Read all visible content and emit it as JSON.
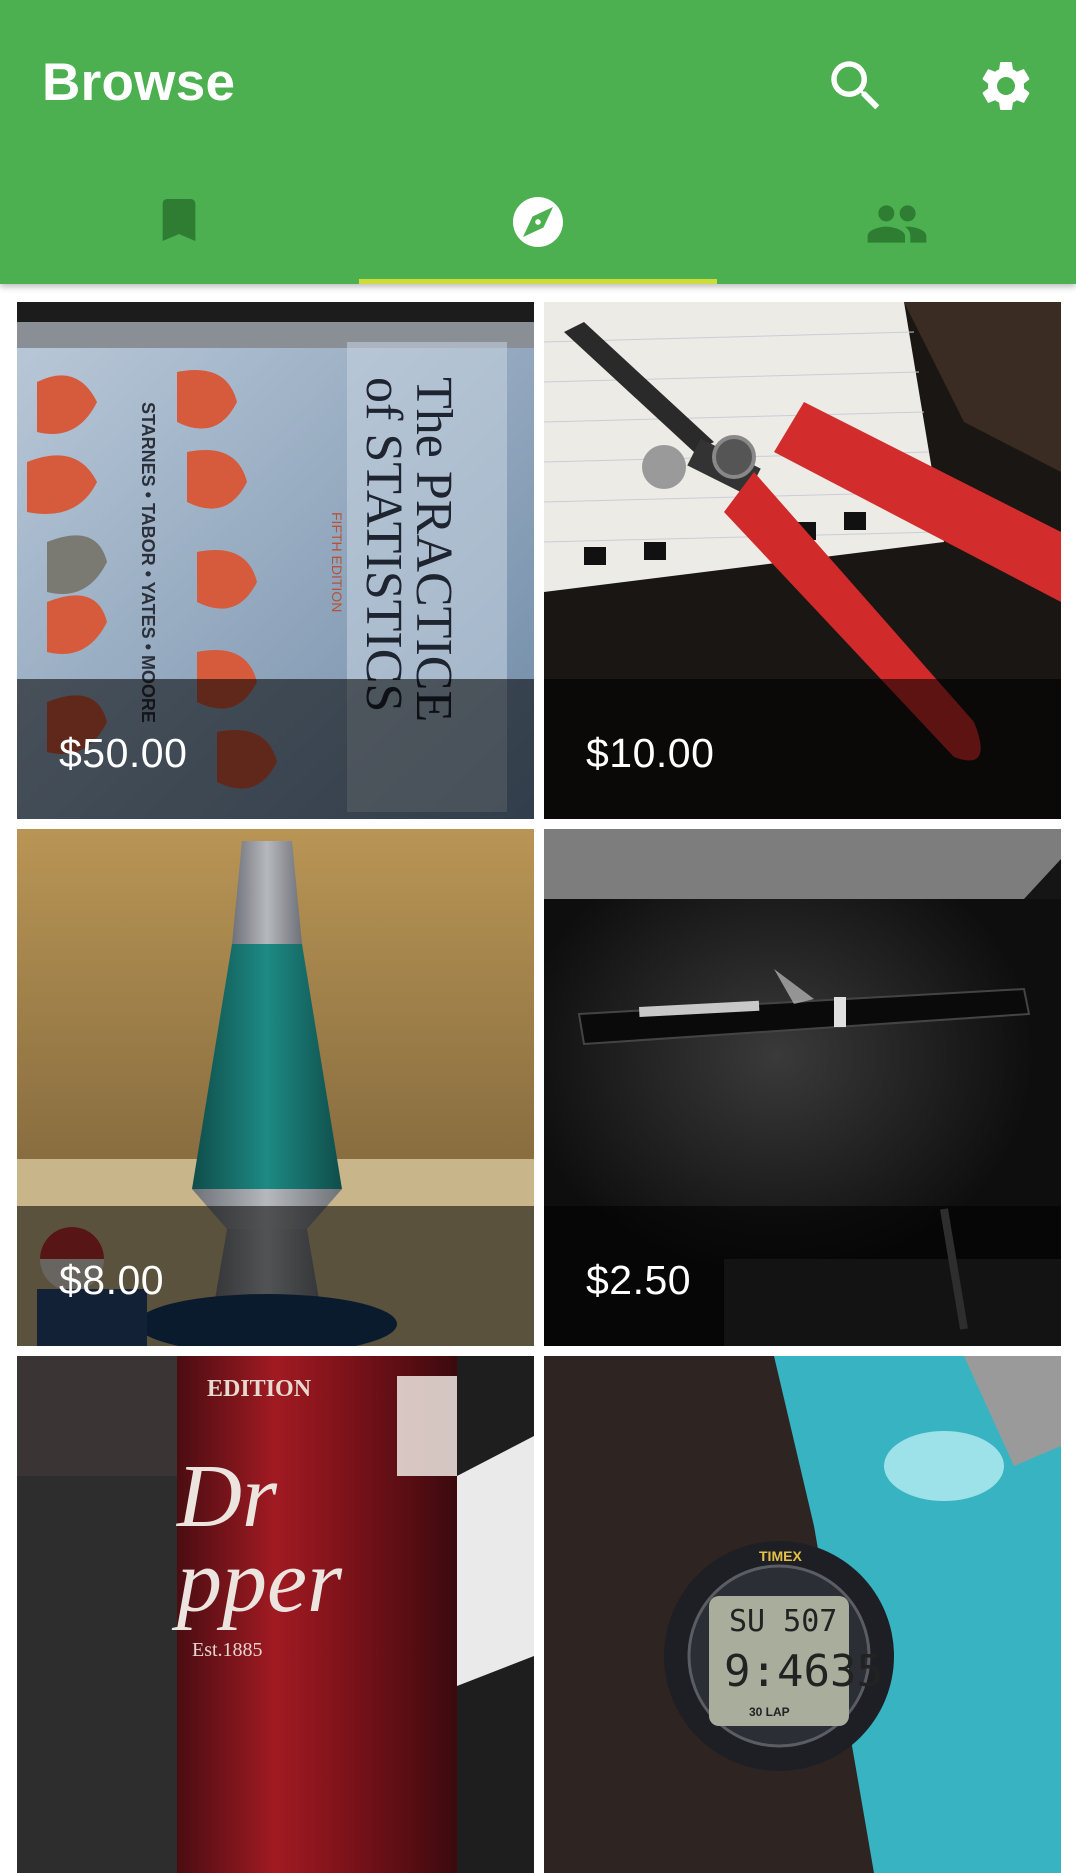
{
  "appbar": {
    "title": "Browse",
    "background_color": "#4caf50",
    "actions": [
      {
        "icon": "search-icon"
      },
      {
        "icon": "gear-icon"
      }
    ]
  },
  "tabs": [
    {
      "icon": "bookmark-icon",
      "active": false
    },
    {
      "icon": "compass-icon",
      "active": true
    },
    {
      "icon": "people-icon",
      "active": false
    }
  ],
  "tab_indicator_color": "#cddc39",
  "listings": [
    {
      "price": "$50.00",
      "photo": "statistics textbook"
    },
    {
      "price": "$10.00",
      "photo": "red wire strippers"
    },
    {
      "price": "$8.00",
      "photo": "lava lamp"
    },
    {
      "price": "$2.50",
      "photo": "black pen"
    },
    {
      "price": "",
      "photo": "soda can"
    },
    {
      "price": "",
      "photo": "digital watch"
    }
  ]
}
